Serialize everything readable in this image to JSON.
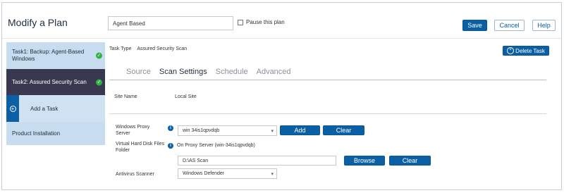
{
  "header": {
    "title": "Modify a Plan",
    "plan_name_value": "Agent Based",
    "pause_label": "Pause this plan",
    "save_label": "Save",
    "cancel_label": "Cancel",
    "help_label": "Help"
  },
  "sidebar": {
    "items": [
      {
        "label": "Task1: Backup: Agent-Based Windows",
        "status": "complete"
      },
      {
        "label": "Task2: Assured Security Scan",
        "status": "complete"
      },
      {
        "label": "Add a Task"
      },
      {
        "label": "Product Installation"
      }
    ]
  },
  "task": {
    "type_label": "Task Type",
    "type_value": "Assured Security Scan",
    "delete_label": "Delete Task"
  },
  "tabs": [
    {
      "label": "Source",
      "active": false
    },
    {
      "label": "Scan Settings",
      "active": true
    },
    {
      "label": "Schedule",
      "active": false
    },
    {
      "label": "Advanced",
      "active": false
    }
  ],
  "form": {
    "site_name_label": "Site Name",
    "site_name_value": "Local Site",
    "proxy_label": "Windows Proxy Server",
    "proxy_value": "win 34is1qpvdqb",
    "add_label": "Add",
    "clear_label": "Clear",
    "vhd_label": "Virtual Hard Disk Files Folder",
    "vhd_info": "On Proxy Server (win-34is1qpvdqb)",
    "vhd_path": "D:\\AS Scan",
    "browse_label": "Browse",
    "clear2_label": "Clear",
    "av_label": "Antivirus Scanner",
    "av_value": "Windows Defender"
  },
  "colors": {
    "primary": "#0b5fa5",
    "sidebar_active": "#3a3850",
    "sidebar_item": "#c7dcee",
    "check": "#2fb344"
  }
}
